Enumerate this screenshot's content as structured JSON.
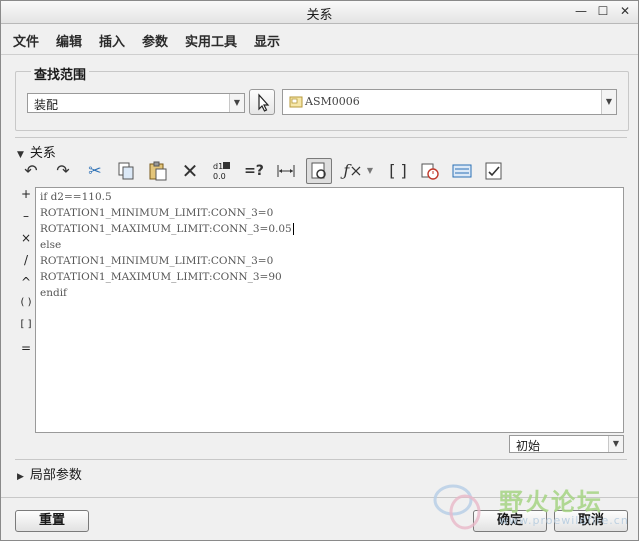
{
  "window": {
    "title": "关系",
    "controls": [
      "—",
      "☐",
      "✕"
    ]
  },
  "menu": [
    "文件",
    "编辑",
    "插入",
    "参数",
    "实用工具",
    "显示"
  ],
  "search_scope": {
    "title": "查找范围",
    "type_value": "装配",
    "target_value": "ASM0006"
  },
  "relations": {
    "section_label": "关系",
    "operators": [
      "+",
      "–",
      "×",
      "/",
      "^",
      "( )",
      "[ ]",
      "="
    ],
    "lines": [
      "if d2==110.5",
      "ROTATION1_MINIMUM_LIMIT:CONN_3=0",
      "ROTATION1_MAXIMUM_LIMIT:CONN_3=0.05",
      "else",
      "ROTATION1_MINIMUM_LIMIT:CONN_3=0",
      "ROTATION1_MAXIMUM_LIMIT:CONN_3=90",
      "endif"
    ],
    "sort_value": "初始"
  },
  "local_params": {
    "label": "局部参数"
  },
  "buttons": {
    "reset": "重置",
    "ok": "确定",
    "cancel": "取消"
  },
  "watermark": {
    "text": "野火论坛",
    "url": "www.proewildfire.cn"
  }
}
